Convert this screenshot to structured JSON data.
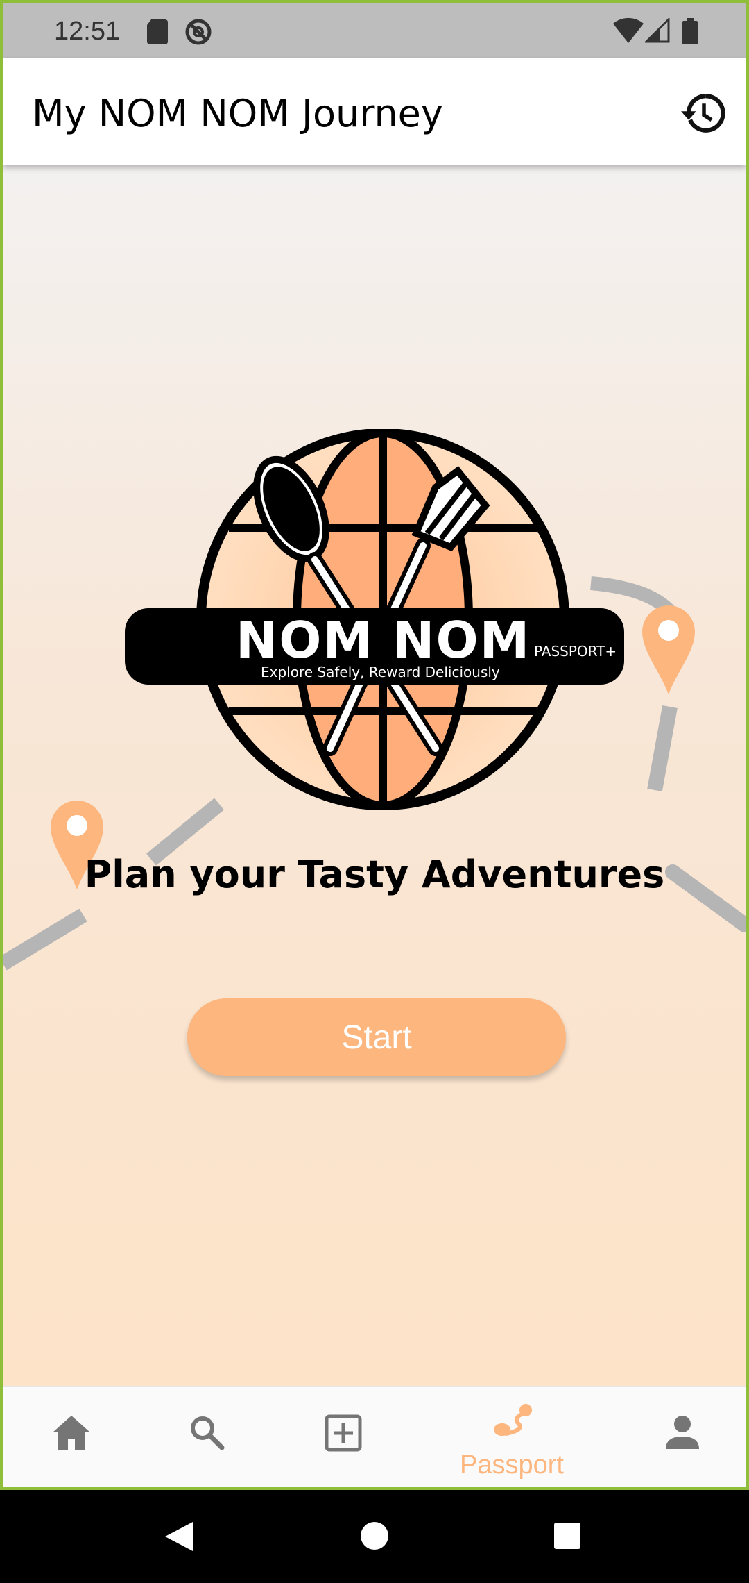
{
  "status_bar": {
    "time": "12:51",
    "icons": [
      "sd-card-icon",
      "do-not-disturb-icon",
      "wifi-icon",
      "signal-icon",
      "battery-icon"
    ]
  },
  "app_bar": {
    "title": "My NOM NOM Journey",
    "action_icon": "history-icon"
  },
  "logo": {
    "brand": "NOM NOM",
    "badge": "PASSPORT+",
    "slogan": "Explore Safely, Reward Deliciously"
  },
  "main": {
    "tagline": "Plan your Tasty Adventures",
    "start_label": "Start"
  },
  "bottom_nav": {
    "items": [
      {
        "icon": "home-icon",
        "label": ""
      },
      {
        "icon": "search-icon",
        "label": ""
      },
      {
        "icon": "add-box-icon",
        "label": ""
      },
      {
        "icon": "passport-route-icon",
        "label": "Passport",
        "active": true
      },
      {
        "icon": "person-icon",
        "label": ""
      }
    ]
  },
  "colors": {
    "accent": "#fcb67e",
    "icon_gray": "#757575",
    "pin_orange": "#fcb67e",
    "path_gray": "#b5b5b5"
  }
}
